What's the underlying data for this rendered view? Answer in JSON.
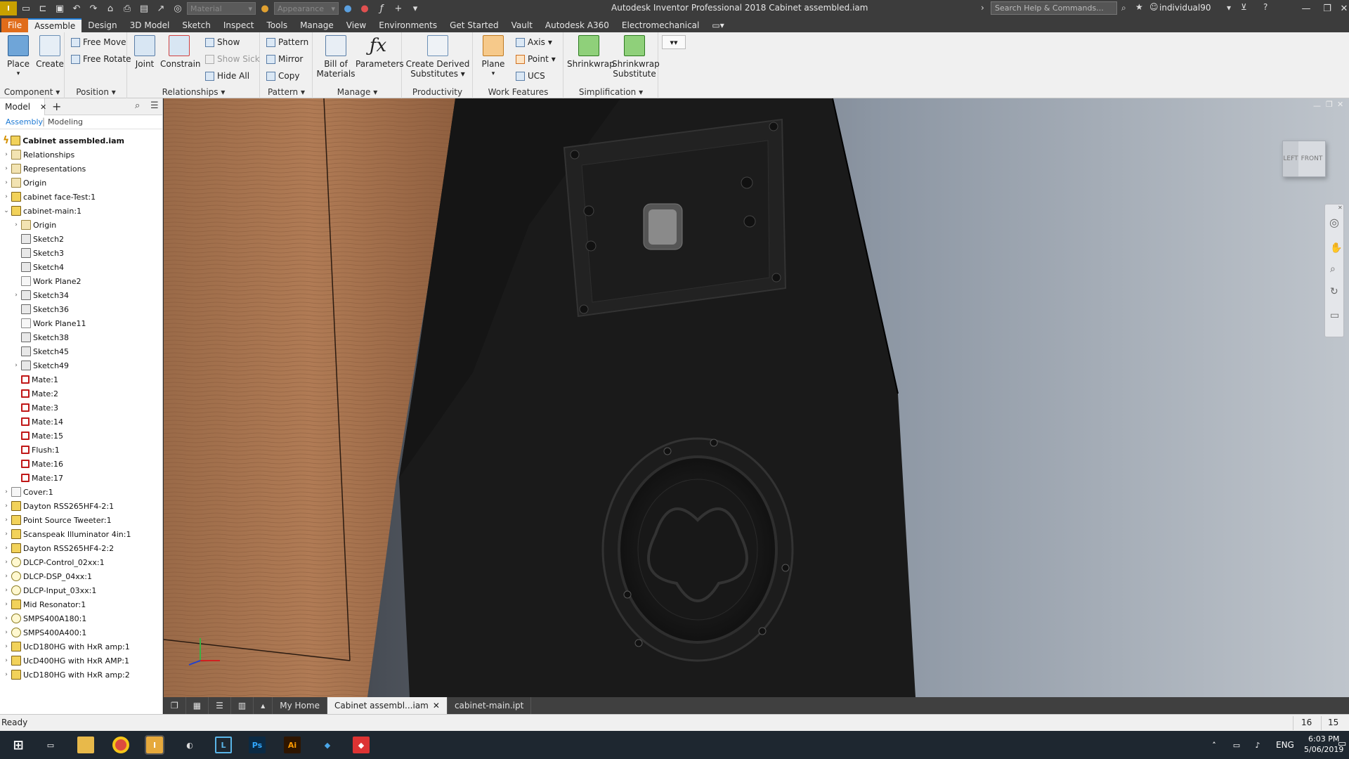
{
  "titlebar": {
    "title": "Autodesk Inventor Professional 2018    Cabinet assembled.iam",
    "material_placeholder": "Material",
    "appearance_placeholder": "Appearance",
    "search_placeholder": "Search Help & Commands...",
    "user": "individual90"
  },
  "tabs": [
    "File",
    "Assemble",
    "Design",
    "3D Model",
    "Sketch",
    "Inspect",
    "Tools",
    "Manage",
    "View",
    "Environments",
    "Get Started",
    "Vault",
    "Autodesk A360",
    "Electromechanical"
  ],
  "ribbon": {
    "component": {
      "title": "Component",
      "place": "Place",
      "create": "Create"
    },
    "position": {
      "title": "Position",
      "free_move": "Free Move",
      "free_rotate": "Free Rotate"
    },
    "relationships": {
      "title": "Relationships",
      "joint": "Joint",
      "constrain": "Constrain",
      "show": "Show",
      "show_sick": "Show Sick",
      "hide_all": "Hide All"
    },
    "pattern": {
      "title": "Pattern",
      "pattern": "Pattern",
      "mirror": "Mirror",
      "copy": "Copy"
    },
    "manage": {
      "title": "Manage",
      "bom_line1": "Bill of",
      "bom_line2": "Materials",
      "parameters": "Parameters"
    },
    "productivity": {
      "title": "Productivity",
      "derived_line1": "Create Derived",
      "derived_line2": "Substitutes"
    },
    "work_features": {
      "title": "Work Features",
      "plane": "Plane",
      "axis": "Axis",
      "point": "Point",
      "ucs": "UCS"
    },
    "simplification": {
      "title": "Simplification",
      "shrinkwrap": "Shrinkwrap",
      "sub_line1": "Shrinkwrap",
      "sub_line2": "Substitute"
    }
  },
  "browser": {
    "tab_model": "Model",
    "sub_assembly": "Assembly",
    "sub_modeling": "Modeling",
    "root": "Cabinet assembled.iam",
    "items": [
      {
        "label": "Relationships",
        "level": 0,
        "icon": "folder",
        "exp": "›"
      },
      {
        "label": "Representations",
        "level": 0,
        "icon": "folder",
        "exp": "›"
      },
      {
        "label": "Origin",
        "level": 0,
        "icon": "folder",
        "exp": "›"
      },
      {
        "label": "cabinet face-Test:1",
        "level": 0,
        "icon": "part",
        "exp": "›"
      },
      {
        "label": "cabinet-main:1",
        "level": 0,
        "icon": "part",
        "exp": "⌄"
      },
      {
        "label": "Origin",
        "level": 1,
        "icon": "folder",
        "exp": "›"
      },
      {
        "label": "Sketch2",
        "level": 1,
        "icon": "sketch",
        "exp": ""
      },
      {
        "label": "Sketch3",
        "level": 1,
        "icon": "sketch",
        "exp": ""
      },
      {
        "label": "Sketch4",
        "level": 1,
        "icon": "sketch",
        "exp": ""
      },
      {
        "label": "Work Plane2",
        "level": 1,
        "icon": "plane",
        "exp": ""
      },
      {
        "label": "Sketch34",
        "level": 1,
        "icon": "sketch",
        "exp": "›"
      },
      {
        "label": "Sketch36",
        "level": 1,
        "icon": "sketch",
        "exp": ""
      },
      {
        "label": "Work Plane11",
        "level": 1,
        "icon": "plane",
        "exp": ""
      },
      {
        "label": "Sketch38",
        "level": 1,
        "icon": "sketch",
        "exp": ""
      },
      {
        "label": "Sketch45",
        "level": 1,
        "icon": "sketch",
        "exp": ""
      },
      {
        "label": "Sketch49",
        "level": 1,
        "icon": "sketch",
        "exp": "›"
      },
      {
        "label": "Mate:1",
        "level": 1,
        "icon": "mate",
        "exp": ""
      },
      {
        "label": "Mate:2",
        "level": 1,
        "icon": "mate",
        "exp": ""
      },
      {
        "label": "Mate:3",
        "level": 1,
        "icon": "mate",
        "exp": ""
      },
      {
        "label": "Mate:14",
        "level": 1,
        "icon": "mate",
        "exp": ""
      },
      {
        "label": "Mate:15",
        "level": 1,
        "icon": "mate",
        "exp": ""
      },
      {
        "label": "Flush:1",
        "level": 1,
        "icon": "mate",
        "exp": ""
      },
      {
        "label": "Mate:16",
        "level": 1,
        "icon": "mate",
        "exp": ""
      },
      {
        "label": "Mate:17",
        "level": 1,
        "icon": "mate",
        "exp": ""
      },
      {
        "label": "Cover:1",
        "level": 0,
        "icon": "plane",
        "exp": "›"
      },
      {
        "label": "Dayton RSS265HF4-2:1",
        "level": 0,
        "icon": "part",
        "exp": "›"
      },
      {
        "label": "Point Source Tweeter:1",
        "level": 0,
        "icon": "part",
        "exp": "›"
      },
      {
        "label": "Scanspeak Illuminator 4in:1",
        "level": 0,
        "icon": "part",
        "exp": "›"
      },
      {
        "label": "Dayton RSS265HF4-2:2",
        "level": 0,
        "icon": "part",
        "exp": "›"
      },
      {
        "label": "DLCP-Control_02xx:1",
        "level": 0,
        "icon": "virtual",
        "exp": "›"
      },
      {
        "label": "DLCP-DSP_04xx:1",
        "level": 0,
        "icon": "virtual",
        "exp": "›"
      },
      {
        "label": "DLCP-Input_03xx:1",
        "level": 0,
        "icon": "virtual",
        "exp": "›"
      },
      {
        "label": "Mid Resonator:1",
        "level": 0,
        "icon": "part",
        "exp": "›"
      },
      {
        "label": "SMPS400A180:1",
        "level": 0,
        "icon": "virtual",
        "exp": "›"
      },
      {
        "label": "SMPS400A400:1",
        "level": 0,
        "icon": "virtual",
        "exp": "›"
      },
      {
        "label": "UcD180HG with HxR amp:1",
        "level": 0,
        "icon": "part",
        "exp": "›"
      },
      {
        "label": "UcD400HG with HxR AMP:1",
        "level": 0,
        "icon": "part",
        "exp": "›"
      },
      {
        "label": "UcD180HG with HxR amp:2",
        "level": 0,
        "icon": "part",
        "exp": "›"
      }
    ]
  },
  "viewcube": {
    "left": "LEFT",
    "front": "FRONT"
  },
  "doc_tabs": {
    "home": "My Home",
    "active": "Cabinet assembl...iam",
    "other": "cabinet-main.ipt"
  },
  "status": {
    "text": "Ready",
    "count1": "16",
    "count2": "15"
  },
  "taskbar": {
    "lang": "ENG",
    "time": "6:03 PM",
    "date": "5/06/2019"
  },
  "colors": {
    "accent": "#1e7ad4",
    "file_tab": "#e06c1a"
  }
}
